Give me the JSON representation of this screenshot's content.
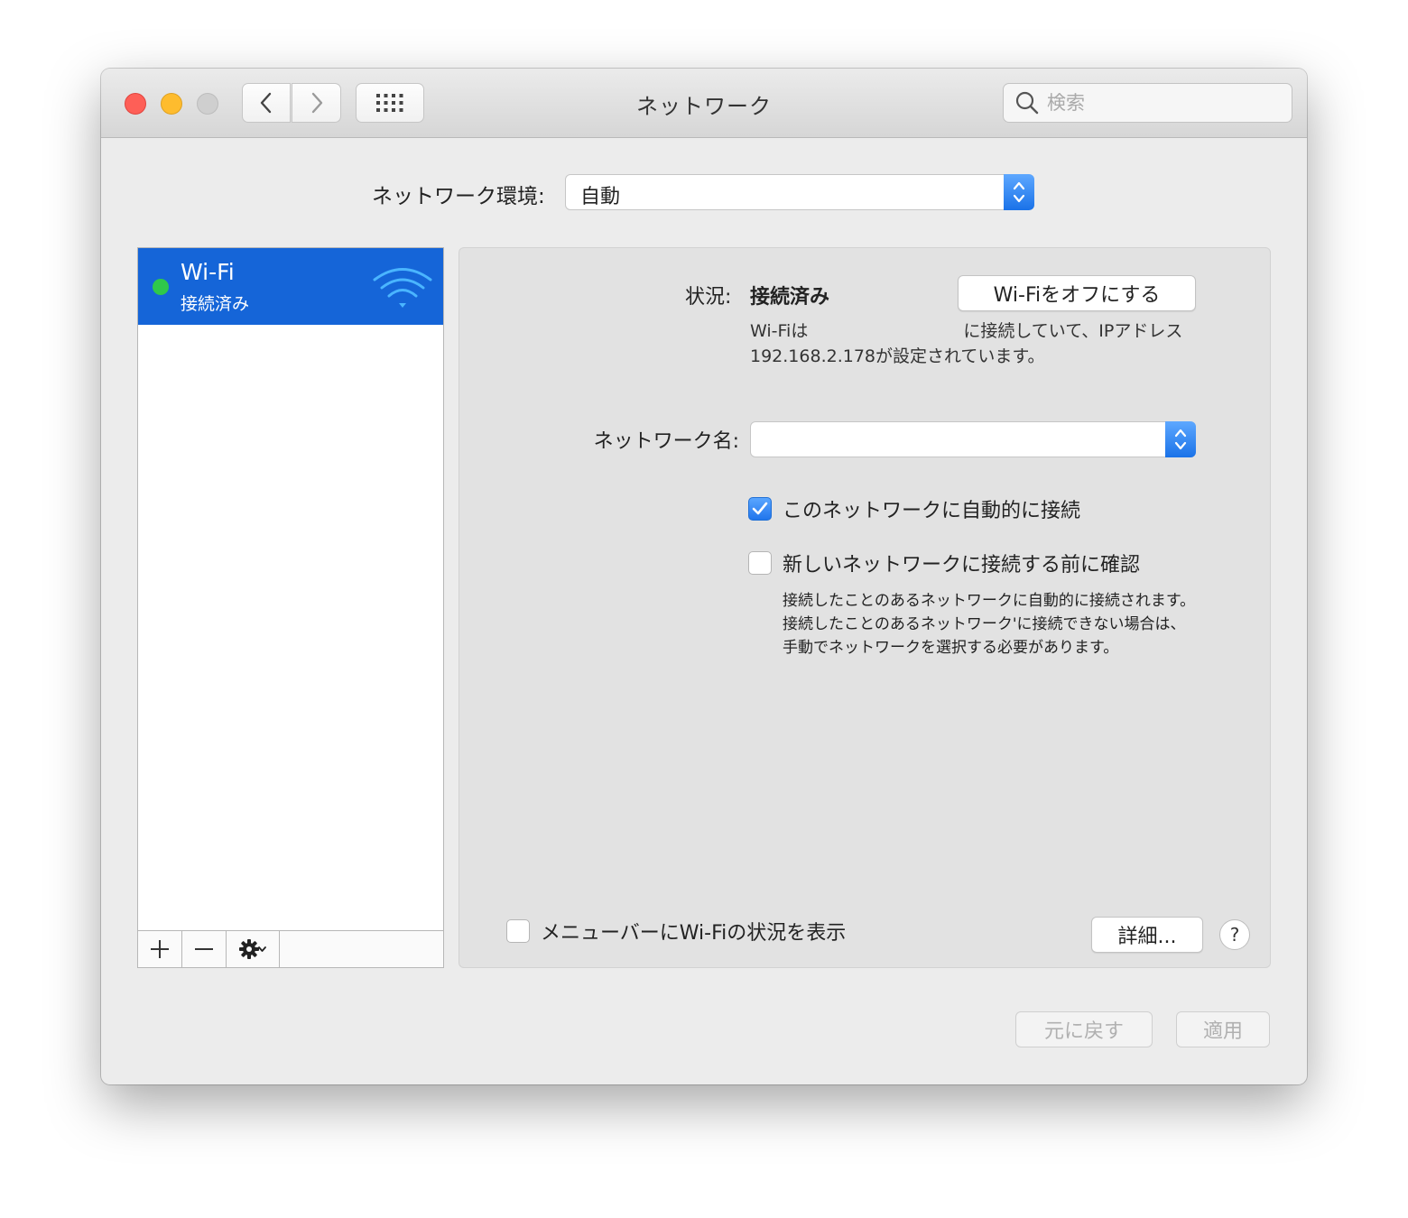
{
  "window": {
    "title": "ネットワーク",
    "search_placeholder": "検索"
  },
  "location": {
    "label": "ネットワーク環境:",
    "value": "自動"
  },
  "services": [
    {
      "name": "Wi-Fi",
      "status": "接続済み",
      "status_color": "#2fc84a"
    }
  ],
  "sidebar_toolbar": {
    "add": "+",
    "remove": "−"
  },
  "detail": {
    "status_label": "状況:",
    "status_value": "接続済み",
    "wifi_off_button": "Wi-Fiをオフにする",
    "status_desc_prefix": "Wi-Fiは",
    "status_desc_suffix": "に接続していて、IPアドレス 192.168.2.178が設定されています。",
    "network_name_label": "ネットワーク名:",
    "network_name_value": "",
    "auto_join_label": "このネットワークに自動的に接続",
    "auto_join_checked": true,
    "ask_join_label": "新しいネットワークに接続する前に確認",
    "ask_join_checked": false,
    "ask_join_desc": "接続したことのあるネットワークに自動的に接続されます。接続したことのあるネットワーク'に接続できない場合は、手動でネットワークを選択する必要があります。",
    "show_menubar_label": "メニューバーにWi-Fiの状況を表示",
    "show_menubar_checked": false,
    "advanced_button": "詳細...",
    "help_button": "?"
  },
  "footer": {
    "revert_button": "元に戻す",
    "apply_button": "適用"
  },
  "colors": {
    "selection": "#1565d8",
    "accent": "#2075ec",
    "close": "#fe5f57",
    "minimize": "#febc2e",
    "zoom": "#cfcfcf"
  }
}
